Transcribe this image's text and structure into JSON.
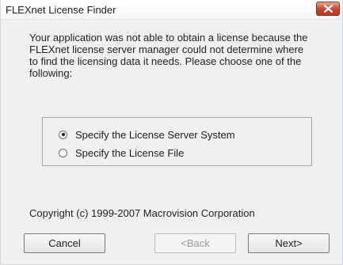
{
  "window": {
    "title": "FLEXnet License Finder"
  },
  "message": "Your application was not able to obtain a license because the FLEXnet license server manager could not determine where to find the licensing data it needs.  Please choose one of the following:",
  "options": [
    {
      "label": "Specify the License Server System",
      "selected": true
    },
    {
      "label": "Specify the License File",
      "selected": false
    }
  ],
  "copyright": "Copyright (c) 1999-2007 Macrovision Corporation",
  "buttons": {
    "cancel": "Cancel",
    "back": "<Back",
    "next": "Next>"
  },
  "icons": {
    "close": "close-icon"
  }
}
